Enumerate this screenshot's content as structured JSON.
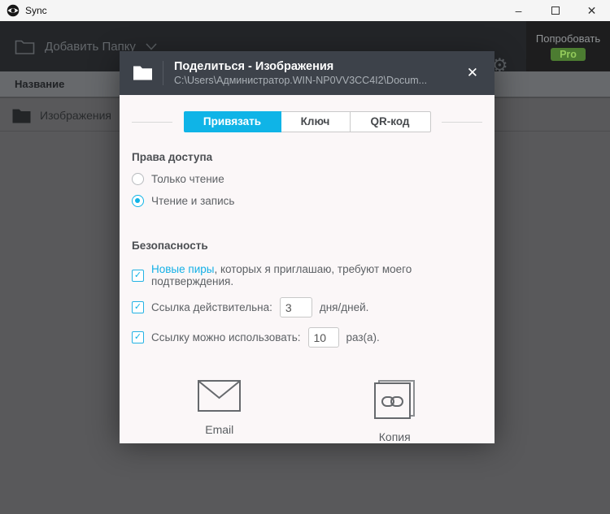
{
  "window": {
    "title": "Sync"
  },
  "icons": {
    "minimize": "–",
    "close": "✕",
    "dialog_close": "✕",
    "checkmark": "✓",
    "gear": "⚙"
  },
  "toolbar": {
    "add_folder_label": "Добавить Папку",
    "try_label": "Попробовать",
    "pro_label": "Pro"
  },
  "table": {
    "name_column_header": "Название",
    "rows": [
      {
        "name": "Изображения"
      }
    ]
  },
  "dialog": {
    "title": "Поделиться - Изображения",
    "path": "C:\\Users\\Администратор.WIN-NP0VV3CC4I2\\Docum...",
    "tabs": [
      {
        "label": "Привязать",
        "active": true
      },
      {
        "label": "Ключ",
        "active": false
      },
      {
        "label": "QR-код",
        "active": false
      }
    ],
    "access": {
      "heading": "Права доступа",
      "options": [
        {
          "label": "Только чтение",
          "selected": false
        },
        {
          "label": "Чтение и запись",
          "selected": true
        }
      ]
    },
    "security": {
      "heading": "Безопасность",
      "peers": {
        "checked": true,
        "link_text": "Новые пиры",
        "rest_text": ", которых я приглашаю, требуют моего подтверждения."
      },
      "link_valid": {
        "checked": true,
        "label": "Ссылка действительна:",
        "value": "3",
        "suffix": "дня/дней."
      },
      "link_uses": {
        "checked": true,
        "label": "Ссылку можно использовать:",
        "value": "10",
        "suffix": "раз(а)."
      }
    },
    "actions": [
      {
        "label": "Email"
      },
      {
        "label": "Копия"
      }
    ]
  },
  "colors": {
    "accent": "#0fb4e7",
    "pro_badge_bg": "#4c7c31",
    "pro_badge_text": "#93ca5b",
    "modal_header_bg": "#3d424a",
    "modal_body_bg": "#fbf7f8"
  }
}
